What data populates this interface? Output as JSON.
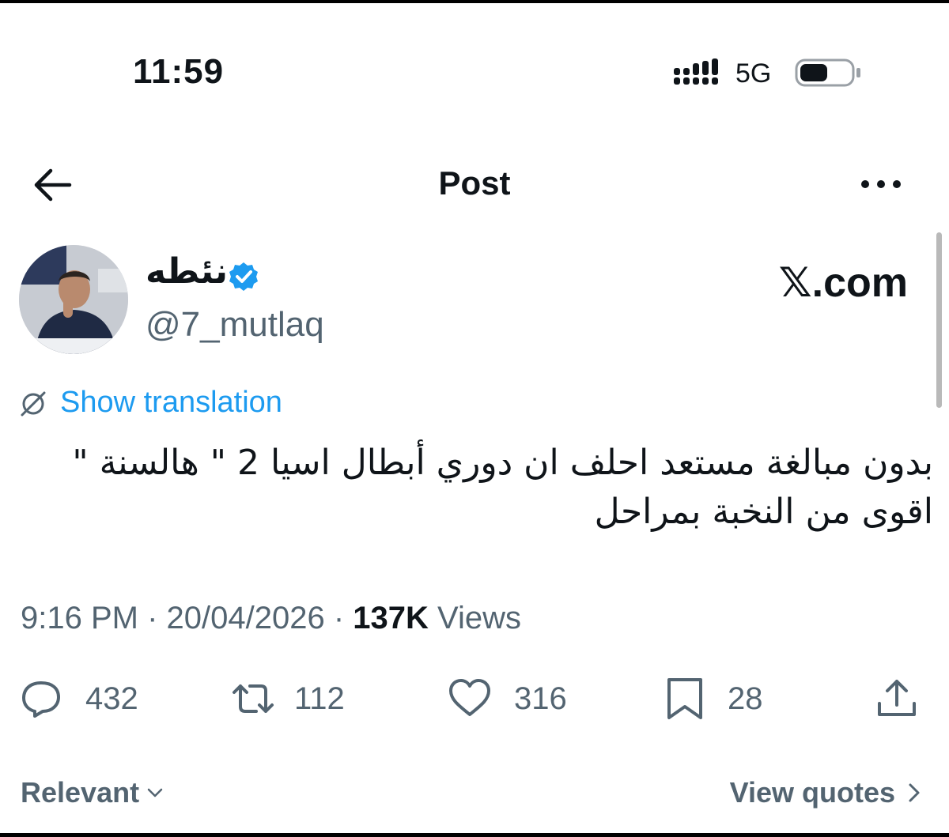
{
  "status_bar": {
    "time": "11:59",
    "network": "5G",
    "battery_level": 0.55
  },
  "header": {
    "title": "Post",
    "back_icon": "arrow-left-icon",
    "more_icon": "ellipsis-icon"
  },
  "author": {
    "display_name": "نئطه",
    "handle": "@7_mutlaq",
    "verified": true,
    "verified_color": "#1d9bf0"
  },
  "watermark": "𝕏.com",
  "translation": {
    "label": "Show translation",
    "color": "#1d9bf0"
  },
  "tweet": {
    "text": "بدون مبالغة مستعد احلف ان دوري أبطال اسيا 2 \" هالسنة \" اقوى من النخبة بمراحل"
  },
  "meta": {
    "time": "9:16 PM",
    "date": "20/04/2026",
    "views_count": "137K",
    "views_label": "Views"
  },
  "actions": {
    "replies": "432",
    "reposts": "112",
    "likes": "316",
    "bookmarks": "28"
  },
  "footer": {
    "sort_label": "Relevant",
    "quotes_label": "View quotes"
  },
  "colors": {
    "text_primary": "#0f1419",
    "text_secondary": "#536471",
    "accent": "#1d9bf0"
  }
}
